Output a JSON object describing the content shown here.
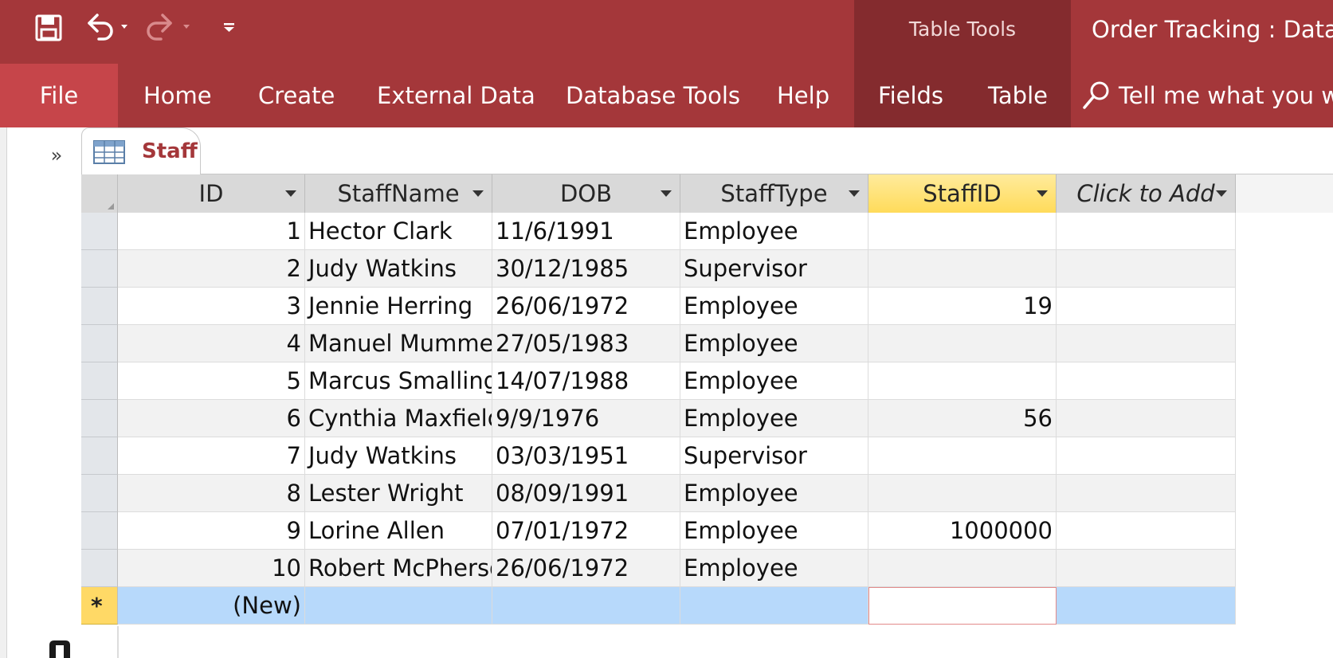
{
  "window": {
    "contextual_group": "Table Tools",
    "title": "Order Tracking : Databa"
  },
  "ribbon": {
    "tabs": [
      {
        "id": "file",
        "label": "File"
      },
      {
        "id": "home",
        "label": "Home"
      },
      {
        "id": "create",
        "label": "Create"
      },
      {
        "id": "external",
        "label": "External Data"
      },
      {
        "id": "dbtools",
        "label": "Database Tools"
      },
      {
        "id": "help",
        "label": "Help"
      },
      {
        "id": "fields",
        "label": "Fields"
      },
      {
        "id": "table",
        "label": "Table"
      }
    ],
    "tell_me": "Tell me what you wa"
  },
  "quick_access": {
    "icons": [
      "save-icon",
      "undo-icon",
      "redo-icon",
      "customize-icon"
    ]
  },
  "nav": {
    "toggle_glyph": "»"
  },
  "document": {
    "tab_label": "Staff"
  },
  "datasheet": {
    "columns": [
      "ID",
      "StaffName",
      "DOB",
      "StaffType",
      "StaffID",
      "Click to Add"
    ],
    "selected_column": "StaffID",
    "rows": [
      {
        "id": "1",
        "name": "Hector Clark",
        "dob": "11/6/1991",
        "type": "Employee",
        "staffid": ""
      },
      {
        "id": "2",
        "name": "Judy Watkins",
        "dob": "30/12/1985",
        "type": "Supervisor",
        "staffid": ""
      },
      {
        "id": "3",
        "name": "Jennie Herring",
        "dob": "26/06/1972",
        "type": "Employee",
        "staffid": "19"
      },
      {
        "id": "4",
        "name": "Manuel Mummert",
        "dob": "27/05/1983",
        "type": "Employee",
        "staffid": ""
      },
      {
        "id": "5",
        "name": "Marcus Smalling",
        "dob": "14/07/1988",
        "type": "Employee",
        "staffid": ""
      },
      {
        "id": "6",
        "name": "Cynthia Maxfield",
        "dob": "9/9/1976",
        "type": "Employee",
        "staffid": "56"
      },
      {
        "id": "7",
        "name": "Judy Watkins",
        "dob": "03/03/1951",
        "type": "Supervisor",
        "staffid": ""
      },
      {
        "id": "8",
        "name": "Lester Wright",
        "dob": "08/09/1991",
        "type": "Employee",
        "staffid": ""
      },
      {
        "id": "9",
        "name": "Lorine Allen",
        "dob": "07/01/1972",
        "type": "Employee",
        "staffid": "1000000"
      },
      {
        "id": "10",
        "name": "Robert McPherson",
        "dob": "26/06/1972",
        "type": "Employee",
        "staffid": ""
      }
    ],
    "new_row": {
      "marker": "*",
      "id_placeholder": "(New)"
    }
  },
  "colors": {
    "ribbon": "#a4373a",
    "file_tab": "#c6454a",
    "contextual_band": "#842b2e",
    "selected_header": "#ffdb5a",
    "new_row": "#b7d9fb"
  }
}
